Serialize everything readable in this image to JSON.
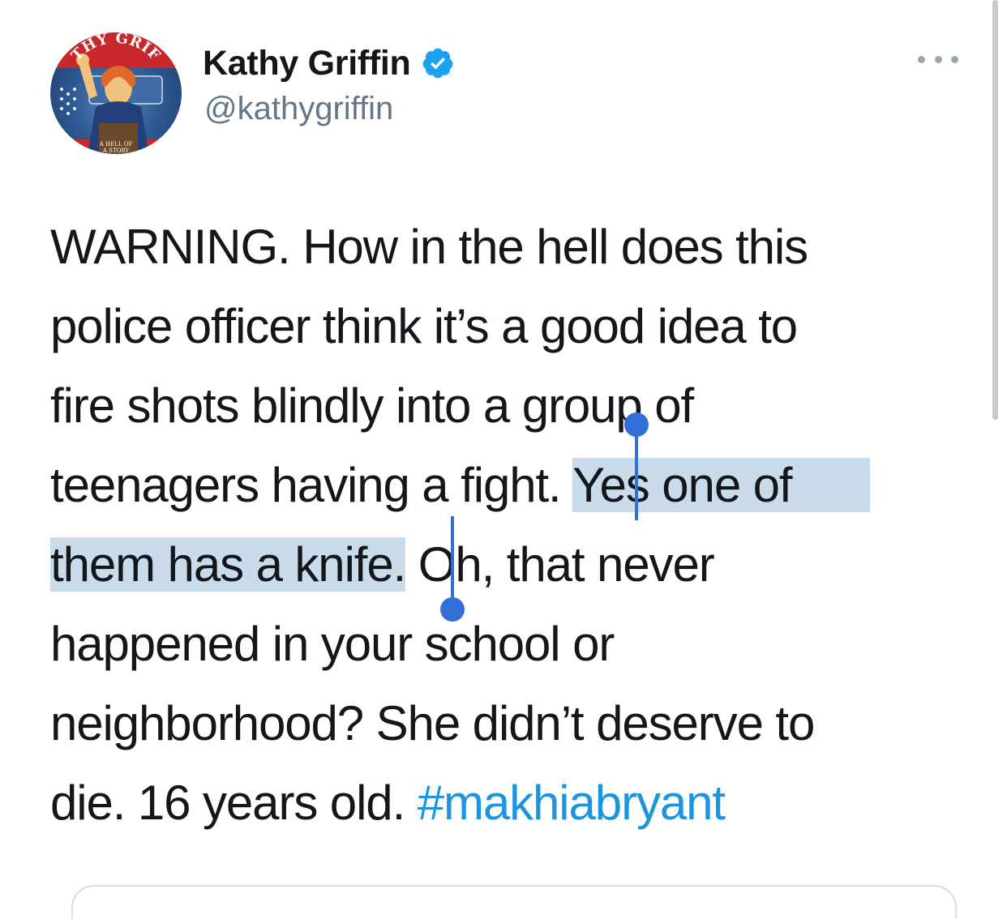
{
  "tweet": {
    "author_name": "Kathy Griffin",
    "author_handle": "@kathygriffin",
    "verified": true,
    "avatar_text": {
      "top": "THY GRIF",
      "bottom_line1": "A HELL OF",
      "bottom_line2": "A STORY"
    },
    "text_lines": {
      "line1": "WARNING. How in the hell does this",
      "line2": "police officer think it’s a good idea to",
      "line3": "fire shots blindly into a group of",
      "line4_plain": "teenagers having a fight. ",
      "line4_selected": "Yes one of",
      "line5_selected": "them has a knife.",
      "line5_plain": " Oh, that never",
      "line6": "happened in your school or",
      "line7": "neighborhood? She didn’t deserve to",
      "line8_plain": "die. 16 years old. ",
      "hashtag": "#makhiabryant"
    }
  },
  "colors": {
    "text": "#14171a",
    "handle": "#657786",
    "hashtag": "#1b95e0",
    "selection_highlight": "#cadcec",
    "selection_caret": "#2f6fd6",
    "verified_badge": "#1da1f2"
  },
  "icons": {
    "verified": "verified-badge-icon",
    "more": "more-options-icon"
  }
}
